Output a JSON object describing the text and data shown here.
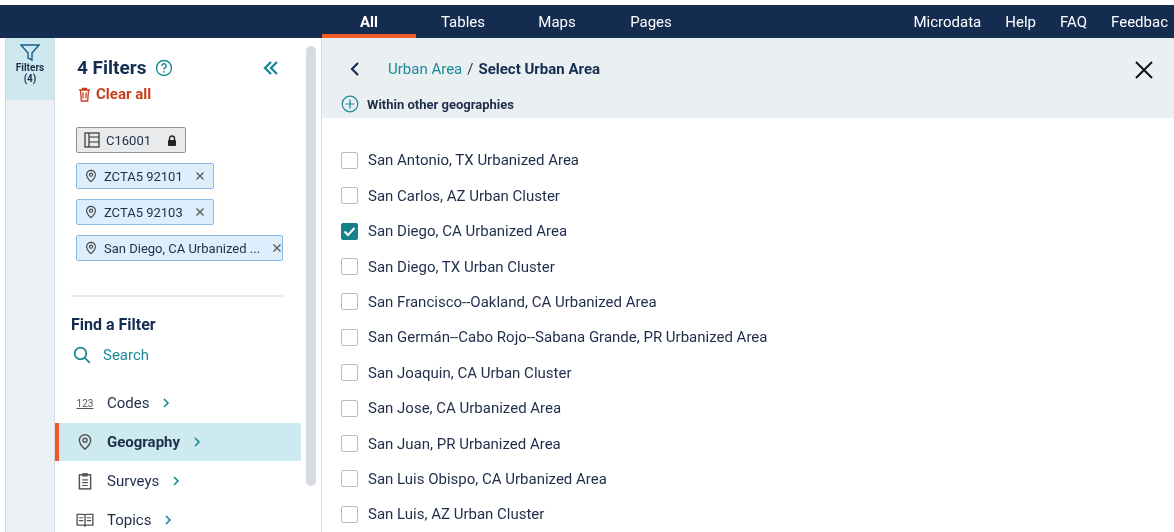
{
  "nav": {
    "tabs": [
      {
        "label": "All",
        "selected": true
      },
      {
        "label": "Tables",
        "selected": false
      },
      {
        "label": "Maps",
        "selected": false
      },
      {
        "label": "Pages",
        "selected": false
      }
    ],
    "links": [
      "Microdata",
      "Help",
      "FAQ",
      "Feedbac"
    ]
  },
  "rail": {
    "label": "Filters",
    "count": "(4)",
    "selected": true
  },
  "filters": {
    "title": "4 Filters",
    "clear": "Clear all",
    "chips": [
      {
        "kind": "table",
        "label": "C16001"
      },
      {
        "kind": "geo",
        "label": "ZCTA5 92101"
      },
      {
        "kind": "geo",
        "label": "ZCTA5 92103"
      },
      {
        "kind": "geo",
        "label": "San Diego, CA Urbanized ..."
      }
    ]
  },
  "find": {
    "title": "Find a Filter",
    "search": "Search",
    "items": [
      {
        "kind": "codes",
        "icon_text": "123",
        "label": "Codes",
        "selected": false
      },
      {
        "kind": "geography",
        "label": "Geography",
        "selected": true
      },
      {
        "kind": "surveys",
        "label": "Surveys",
        "selected": false
      },
      {
        "kind": "topics",
        "label": "Topics",
        "selected": false
      }
    ]
  },
  "main": {
    "breadcrumb": {
      "parent": "Urban Area",
      "separator": "/",
      "current": "Select Urban Area"
    },
    "within": "Within other geographies",
    "options": [
      {
        "label": "San Antonio, TX Urbanized Area",
        "checked": false
      },
      {
        "label": "San Carlos, AZ Urban Cluster",
        "checked": false
      },
      {
        "label": "San Diego, CA Urbanized Area",
        "checked": true
      },
      {
        "label": "San Diego, TX Urban Cluster",
        "checked": false
      },
      {
        "label": "San Francisco--Oakland, CA Urbanized Area",
        "checked": false
      },
      {
        "label": "San Germán--Cabo Rojo--Sabana Grande, PR Urbanized Area",
        "checked": false
      },
      {
        "label": "San Joaquin, CA Urban Cluster",
        "checked": false
      },
      {
        "label": "San Jose, CA Urbanized Area",
        "checked": false
      },
      {
        "label": "San Juan, PR Urbanized Area",
        "checked": false
      },
      {
        "label": "San Luis Obispo, CA Urbanized Area",
        "checked": false
      },
      {
        "label": "San Luis, AZ Urban Cluster",
        "checked": false
      }
    ]
  }
}
